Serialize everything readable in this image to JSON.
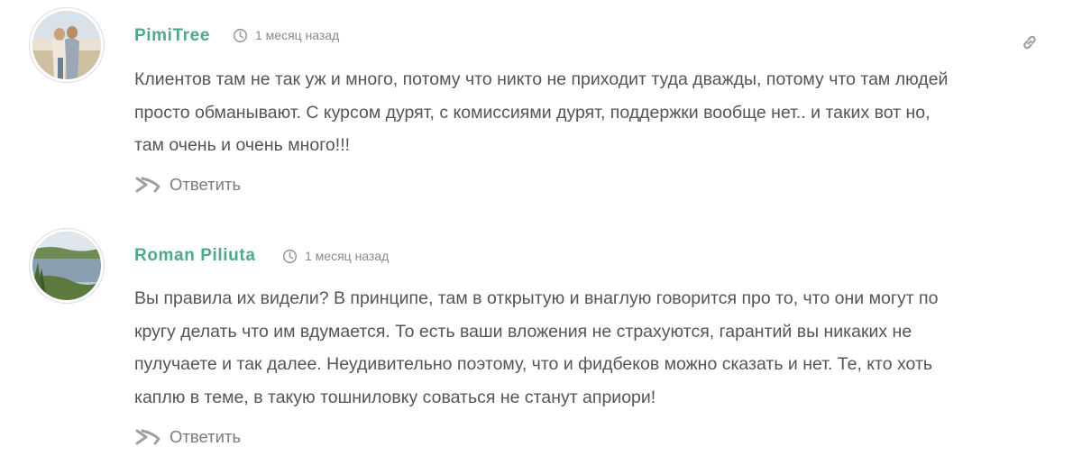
{
  "comments": [
    {
      "author": "PimiTree",
      "time": "1 месяц назад",
      "body_lines": [
        "Клиентов там не так уж и много, потому что никто не приходит туда дважды, потому что там людей",
        "просто обманывают. С курсом дурят, с комиссиями дурят, поддержки вообще нет.. и таких вот но,",
        "там очень и очень много!!!"
      ],
      "reply_label": "Ответить",
      "icons": {
        "time": "clock-icon",
        "reply": "reply-arrow-icon",
        "permalink": "link-icon"
      }
    },
    {
      "author": "Roman Piliuta",
      "time": "1 месяц назад",
      "body_lines": [
        "Вы правила их видели? В принципе, там в открытую и внаглую говорится про то, что они могут по",
        "кругу делать что им вдумается. То есть ваши вложения не страхуются, гарантий вы никаких не",
        "пулучаете и так далее. Неудивительно поэтому, что и фидбеков можно сказать и нет. Те, кто хоть",
        "каплю в теме, в такую тошниловку соваться не станут априори!"
      ],
      "reply_label": "Ответить",
      "icons": {
        "time": "clock-icon",
        "reply": "reply-arrow-icon"
      }
    }
  ],
  "colors": {
    "author": "#4cab85",
    "text": "#555555",
    "meta": "#8a8a8a",
    "icon": "#9a9a9a"
  }
}
